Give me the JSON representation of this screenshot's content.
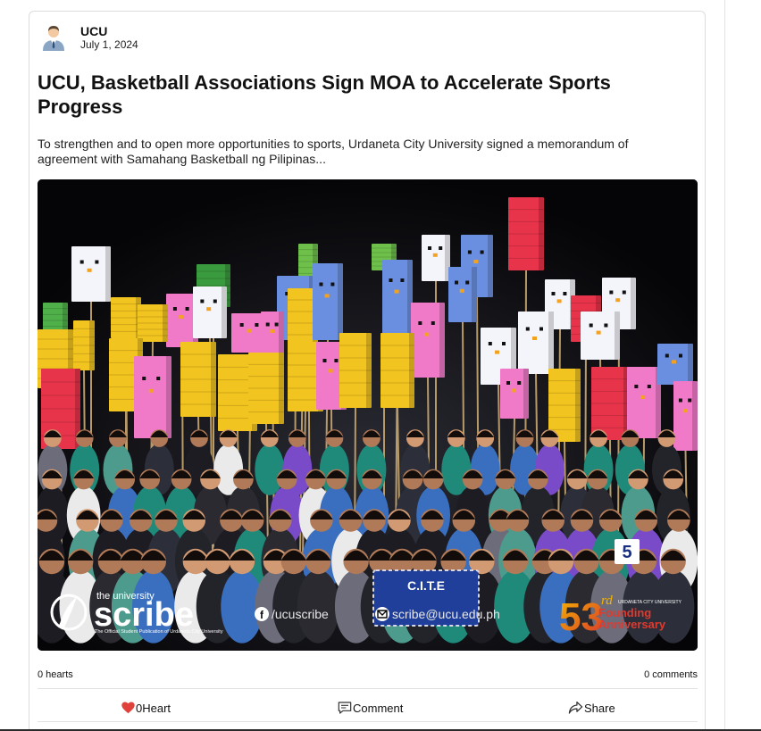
{
  "post": {
    "author": "UCU",
    "date": "July 1, 2024",
    "title": "UCU, Basketball Associations Sign MOA to Accelerate Sports Progress",
    "excerpt": "To strengthen and to open more opportunities to sports, Urdaneta City University signed a memorandum of agreement with Samahang Basketball ng Pilipinas...",
    "photo": {
      "watermark_small": "the university",
      "watermark_brand": "scribe",
      "watermark_tagline": "The Official Student Publication of Urdaneta City University",
      "facebook": "/ucuscribe",
      "email": "scribe@ucu.edu.ph",
      "anniversary_number": "53",
      "anniversary_suffix": "rd",
      "anniversary_uni": "URDANETA CITY UNIVERSITY",
      "anniversary_line1": "Founding",
      "anniversary_line2": "Anniversary",
      "banner_text": "C.I.T.E",
      "placard_number": "5"
    }
  },
  "stats": {
    "hearts": "0 hearts",
    "comments": "0 comments"
  },
  "actions": {
    "heart_label": "0Heart",
    "comment_label": "Comment",
    "share_label": "Share"
  },
  "colors": {
    "heart": "#e0413a",
    "card_border": "#dcdcdc",
    "photo_bg": "#07070a"
  }
}
